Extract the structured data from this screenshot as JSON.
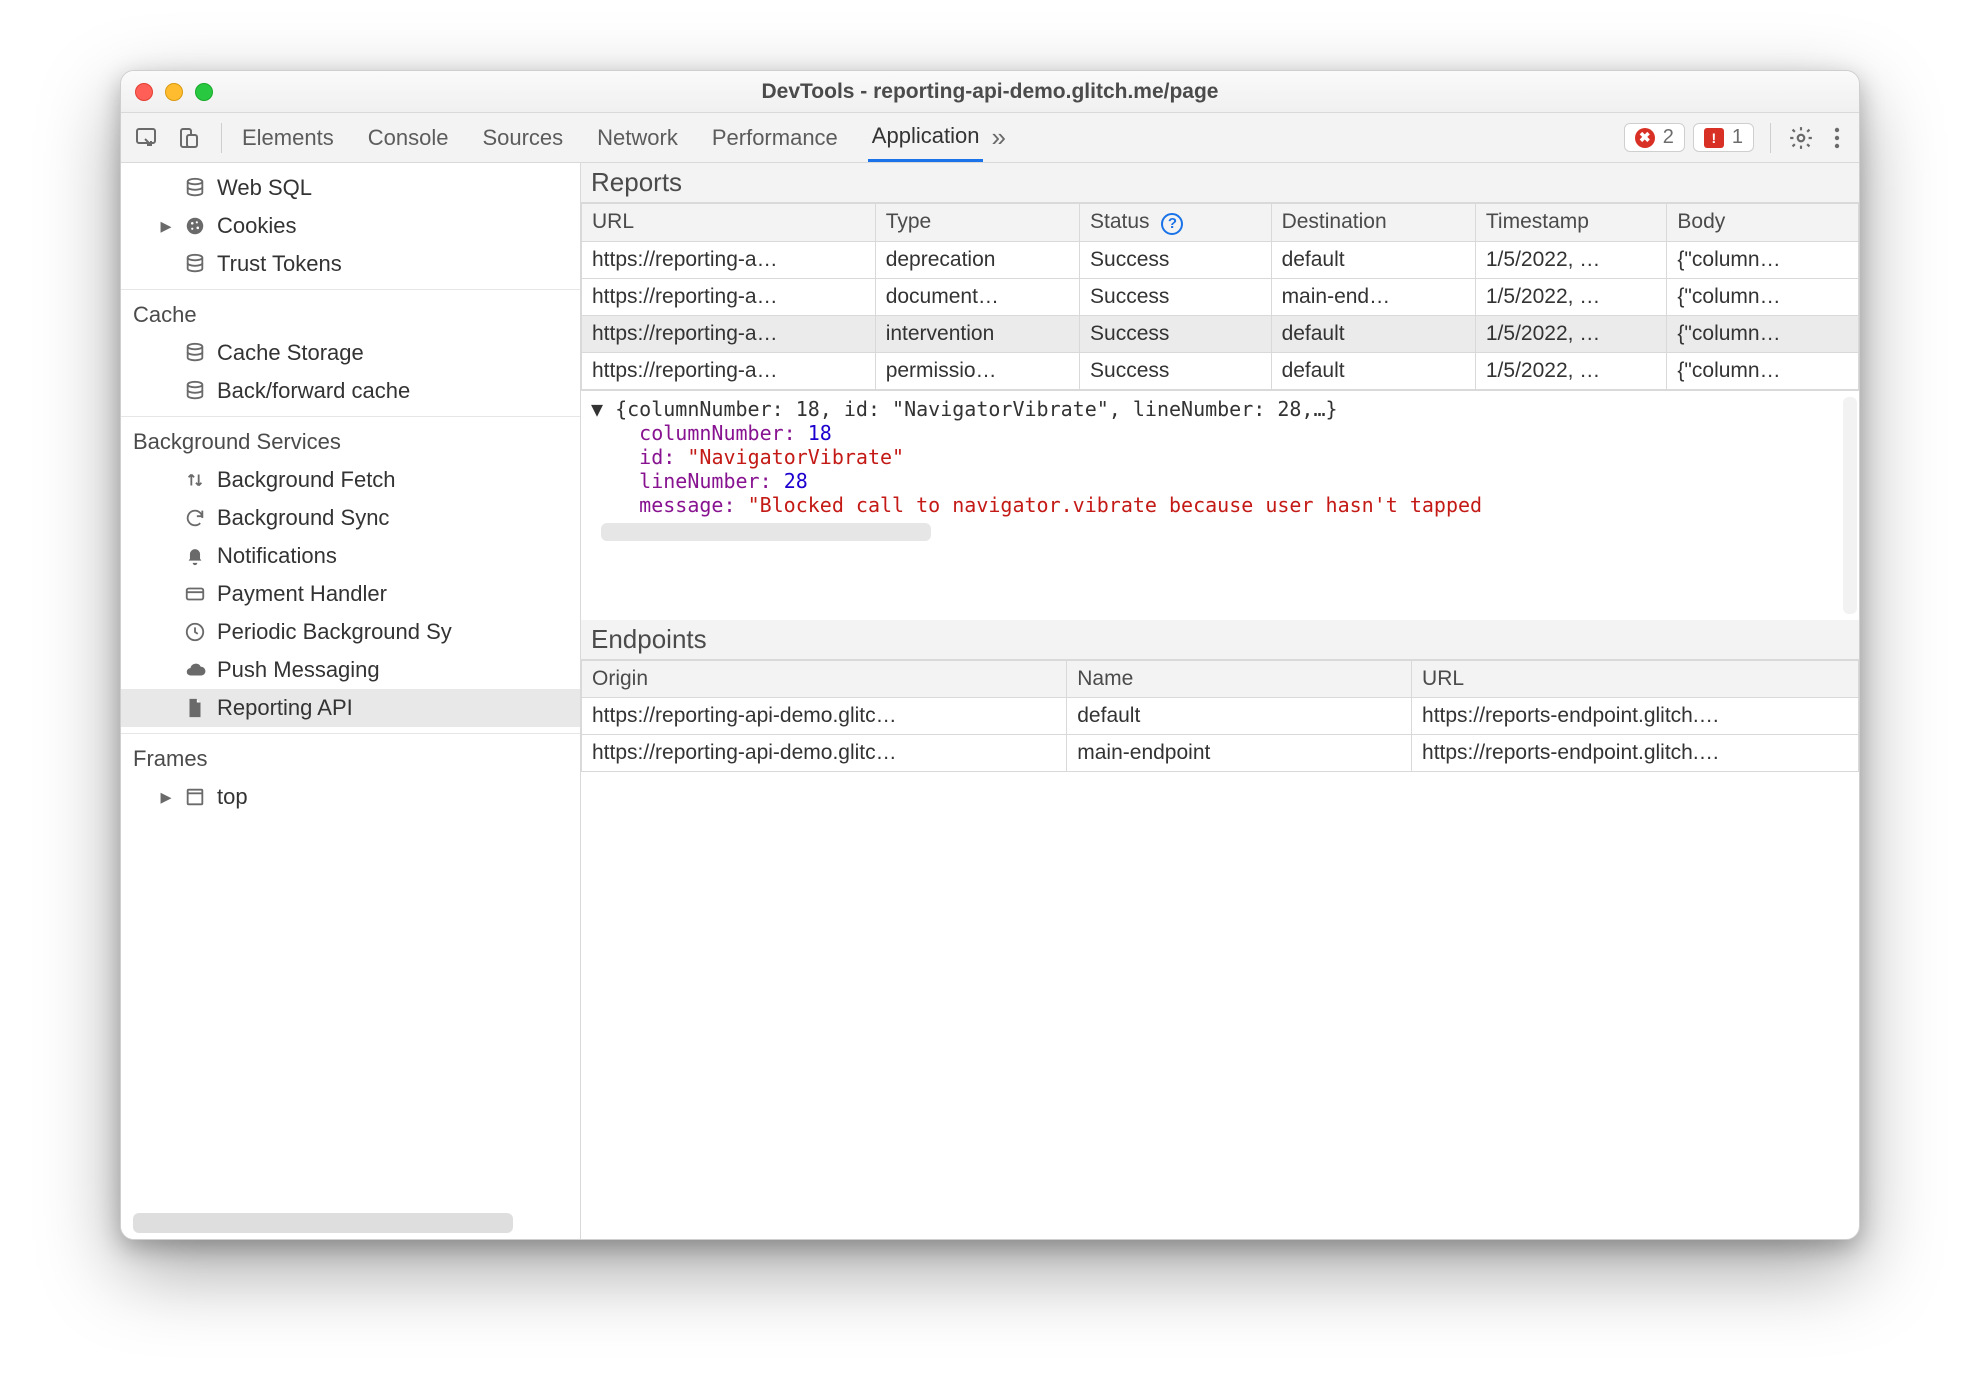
{
  "window": {
    "title": "DevTools - reporting-api-demo.glitch.me/page"
  },
  "toolbar": {
    "tabs": [
      "Elements",
      "Console",
      "Sources",
      "Network",
      "Performance",
      "Application"
    ],
    "active_tab": "Application",
    "errors": "2",
    "issues": "1"
  },
  "sidebar": {
    "group_storage": [
      {
        "label": "Web SQL",
        "icon": "database",
        "caret": false
      },
      {
        "label": "Cookies",
        "icon": "cookie",
        "caret": true
      },
      {
        "label": "Trust Tokens",
        "icon": "database",
        "caret": false
      }
    ],
    "group_cache_title": "Cache",
    "group_cache": [
      {
        "label": "Cache Storage",
        "icon": "database",
        "caret": false
      },
      {
        "label": "Back/forward cache",
        "icon": "database",
        "caret": false
      }
    ],
    "group_bg_title": "Background Services",
    "group_bg": [
      {
        "label": "Background Fetch",
        "icon": "updown",
        "caret": false
      },
      {
        "label": "Background Sync",
        "icon": "sync",
        "caret": false
      },
      {
        "label": "Notifications",
        "icon": "bell",
        "caret": false
      },
      {
        "label": "Payment Handler",
        "icon": "card",
        "caret": false
      },
      {
        "label": "Periodic Background Sy",
        "icon": "clock",
        "caret": false
      },
      {
        "label": "Push Messaging",
        "icon": "cloud",
        "caret": false
      },
      {
        "label": "Reporting API",
        "icon": "file",
        "caret": false,
        "selected": true
      }
    ],
    "group_frames_title": "Frames",
    "group_frames": [
      {
        "label": "top",
        "icon": "frame",
        "caret": true
      }
    ]
  },
  "reports": {
    "title": "Reports",
    "columns": [
      "URL",
      "Type",
      "Status",
      "Destination",
      "Timestamp",
      "Body"
    ],
    "rows": [
      {
        "url": "https://reporting-a…",
        "type": "deprecation",
        "status": "Success",
        "dest": "default",
        "ts": "1/5/2022, …",
        "body": "{\"column…"
      },
      {
        "url": "https://reporting-a…",
        "type": "document…",
        "status": "Success",
        "dest": "main-end…",
        "ts": "1/5/2022, …",
        "body": "{\"column…"
      },
      {
        "url": "https://reporting-a…",
        "type": "intervention",
        "status": "Success",
        "dest": "default",
        "ts": "1/5/2022, …",
        "body": "{\"column…",
        "selected": true
      },
      {
        "url": "https://reporting-a…",
        "type": "permissio…",
        "status": "Success",
        "dest": "default",
        "ts": "1/5/2022, …",
        "body": "{\"column…"
      }
    ]
  },
  "detail": {
    "summary": "{columnNumber: 18, id: \"NavigatorVibrate\", lineNumber: 28,…}",
    "columnNumber_key": "columnNumber",
    "columnNumber_val": "18",
    "id_key": "id",
    "id_val": "\"NavigatorVibrate\"",
    "lineNumber_key": "lineNumber",
    "lineNumber_val": "28",
    "message_key": "message",
    "message_val": "\"Blocked call to navigator.vibrate because user hasn't tapped"
  },
  "endpoints": {
    "title": "Endpoints",
    "columns": [
      "Origin",
      "Name",
      "URL"
    ],
    "rows": [
      {
        "origin": "https://reporting-api-demo.glitc…",
        "name": "default",
        "url": "https://reports-endpoint.glitch.…"
      },
      {
        "origin": "https://reporting-api-demo.glitc…",
        "name": "main-endpoint",
        "url": "https://reports-endpoint.glitch.…"
      }
    ]
  }
}
